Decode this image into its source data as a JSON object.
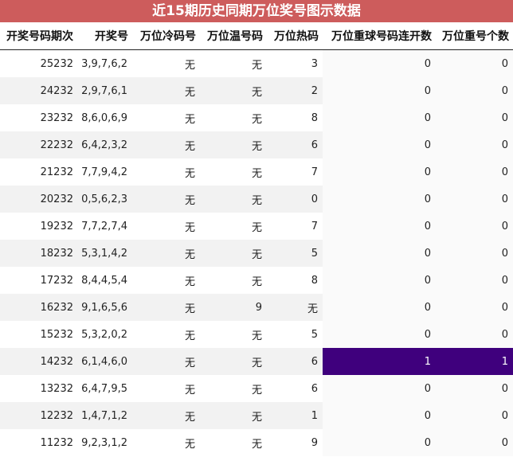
{
  "title": "近15期历史同期万位奖号图示数据",
  "headers": [
    "开奖号码期次",
    "开奖号",
    "万位冷码号",
    "万位温号码",
    "万位热码",
    "万位重球号码连开数",
    "万位重号个数"
  ],
  "colors": {
    "title_bg": "#cd5c5c",
    "highlight": "#3f007d"
  },
  "rows": [
    {
      "issue": "25232",
      "numbers": "3,9,7,6,2",
      "cold": "无",
      "warm": "无",
      "hot": "3",
      "repeat_streak": "0",
      "repeat_count": "0"
    },
    {
      "issue": "24232",
      "numbers": "2,9,7,6,1",
      "cold": "无",
      "warm": "无",
      "hot": "2",
      "repeat_streak": "0",
      "repeat_count": "0"
    },
    {
      "issue": "23232",
      "numbers": "8,6,0,6,9",
      "cold": "无",
      "warm": "无",
      "hot": "8",
      "repeat_streak": "0",
      "repeat_count": "0"
    },
    {
      "issue": "22232",
      "numbers": "6,4,2,3,2",
      "cold": "无",
      "warm": "无",
      "hot": "6",
      "repeat_streak": "0",
      "repeat_count": "0"
    },
    {
      "issue": "21232",
      "numbers": "7,7,9,4,2",
      "cold": "无",
      "warm": "无",
      "hot": "7",
      "repeat_streak": "0",
      "repeat_count": "0"
    },
    {
      "issue": "20232",
      "numbers": "0,5,6,2,3",
      "cold": "无",
      "warm": "无",
      "hot": "0",
      "repeat_streak": "0",
      "repeat_count": "0"
    },
    {
      "issue": "19232",
      "numbers": "7,7,2,7,4",
      "cold": "无",
      "warm": "无",
      "hot": "7",
      "repeat_streak": "0",
      "repeat_count": "0"
    },
    {
      "issue": "18232",
      "numbers": "5,3,1,4,2",
      "cold": "无",
      "warm": "无",
      "hot": "5",
      "repeat_streak": "0",
      "repeat_count": "0"
    },
    {
      "issue": "17232",
      "numbers": "8,4,4,5,4",
      "cold": "无",
      "warm": "无",
      "hot": "8",
      "repeat_streak": "0",
      "repeat_count": "0"
    },
    {
      "issue": "16232",
      "numbers": "9,1,6,5,6",
      "cold": "无",
      "warm": "9",
      "hot": "无",
      "repeat_streak": "0",
      "repeat_count": "0"
    },
    {
      "issue": "15232",
      "numbers": "5,3,2,0,2",
      "cold": "无",
      "warm": "无",
      "hot": "5",
      "repeat_streak": "0",
      "repeat_count": "0"
    },
    {
      "issue": "14232",
      "numbers": "6,1,4,6,0",
      "cold": "无",
      "warm": "无",
      "hot": "6",
      "repeat_streak": "1",
      "repeat_count": "1",
      "highlight": true
    },
    {
      "issue": "13232",
      "numbers": "6,4,7,9,5",
      "cold": "无",
      "warm": "无",
      "hot": "6",
      "repeat_streak": "0",
      "repeat_count": "0"
    },
    {
      "issue": "12232",
      "numbers": "1,4,7,1,2",
      "cold": "无",
      "warm": "无",
      "hot": "1",
      "repeat_streak": "0",
      "repeat_count": "0"
    },
    {
      "issue": "11232",
      "numbers": "9,2,3,1,2",
      "cold": "无",
      "warm": "无",
      "hot": "9",
      "repeat_streak": "0",
      "repeat_count": "0"
    }
  ]
}
